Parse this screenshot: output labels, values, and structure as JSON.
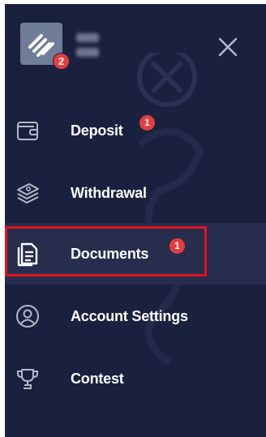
{
  "header": {
    "logo_icon": "brand-stripes-icon",
    "notification_count": "2",
    "close_icon": "close-icon"
  },
  "menu": {
    "items": [
      {
        "label": "Deposit",
        "icon": "wallet-icon",
        "badge": "1"
      },
      {
        "label": "Withdrawal",
        "icon": "money-stack-icon"
      },
      {
        "label": "Documents",
        "icon": "document-icon",
        "badge": "1",
        "active": true
      },
      {
        "label": "Account Settings",
        "icon": "user-circle-icon"
      },
      {
        "label": "Contest",
        "icon": "trophy-icon"
      }
    ]
  },
  "colors": {
    "panel_background": "#1a213f",
    "active_background": "#262d4d",
    "badge": "#e43d3d",
    "highlight_border": "#e5121b",
    "icon": "#b3b9c8",
    "text": "#ffffff"
  }
}
